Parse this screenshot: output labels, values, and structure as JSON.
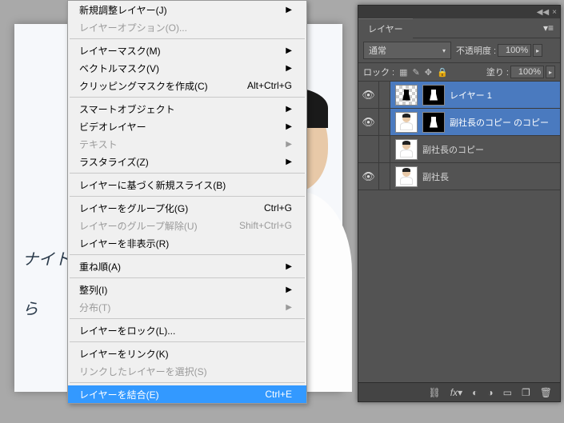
{
  "menu": {
    "items": [
      {
        "label": "新規調整レイヤー(J)",
        "arrow": true,
        "disabled": false
      },
      {
        "label": "レイヤーオプション(O)...",
        "disabled": true
      },
      {
        "sep": true
      },
      {
        "label": "レイヤーマスク(M)",
        "arrow": true
      },
      {
        "label": "ベクトルマスク(V)",
        "arrow": true
      },
      {
        "label": "クリッピングマスクを作成(C)",
        "shortcut": "Alt+Ctrl+G"
      },
      {
        "sep": true
      },
      {
        "label": "スマートオブジェクト",
        "arrow": true
      },
      {
        "label": "ビデオレイヤー",
        "arrow": true
      },
      {
        "label": "テキスト",
        "arrow": true,
        "disabled": true
      },
      {
        "label": "ラスタライズ(Z)",
        "arrow": true
      },
      {
        "sep": true
      },
      {
        "label": "レイヤーに基づく新規スライス(B)"
      },
      {
        "sep": true
      },
      {
        "label": "レイヤーをグループ化(G)",
        "shortcut": "Ctrl+G"
      },
      {
        "label": "レイヤーのグループ解除(U)",
        "shortcut": "Shift+Ctrl+G",
        "disabled": true
      },
      {
        "label": "レイヤーを非表示(R)"
      },
      {
        "sep": true
      },
      {
        "label": "重ね順(A)",
        "arrow": true
      },
      {
        "sep": true
      },
      {
        "label": "整列(I)",
        "arrow": true
      },
      {
        "label": "分布(T)",
        "arrow": true,
        "disabled": true
      },
      {
        "sep": true
      },
      {
        "label": "レイヤーをロック(L)..."
      },
      {
        "sep": true
      },
      {
        "label": "レイヤーをリンク(K)"
      },
      {
        "label": "リンクしたレイヤーを選択(S)",
        "disabled": true
      },
      {
        "sep": true
      },
      {
        "label": "レイヤーを結合(E)",
        "shortcut": "Ctrl+E",
        "highlight": true
      }
    ]
  },
  "panel": {
    "tab": "レイヤー",
    "blend_mode": "通常",
    "opacity_label": "不透明度 :",
    "opacity_value": "100%",
    "lock_label": "ロック :",
    "fill_label": "塗り :",
    "fill_value": "100%",
    "layers": [
      {
        "name": "レイヤー 1",
        "visible": true,
        "selected": true,
        "thumb": "checker-shape",
        "mask": true
      },
      {
        "name": "副社長のコピー のコピー",
        "visible": true,
        "selected": true,
        "thumb": "person",
        "mask": true
      },
      {
        "name": "副社長のコピー",
        "visible": false,
        "selected": false,
        "thumb": "person"
      },
      {
        "name": "副社長",
        "visible": true,
        "selected": false,
        "thumb": "person"
      }
    ]
  },
  "scribbles": {
    "a": "ナイト",
    "b": "ら"
  }
}
